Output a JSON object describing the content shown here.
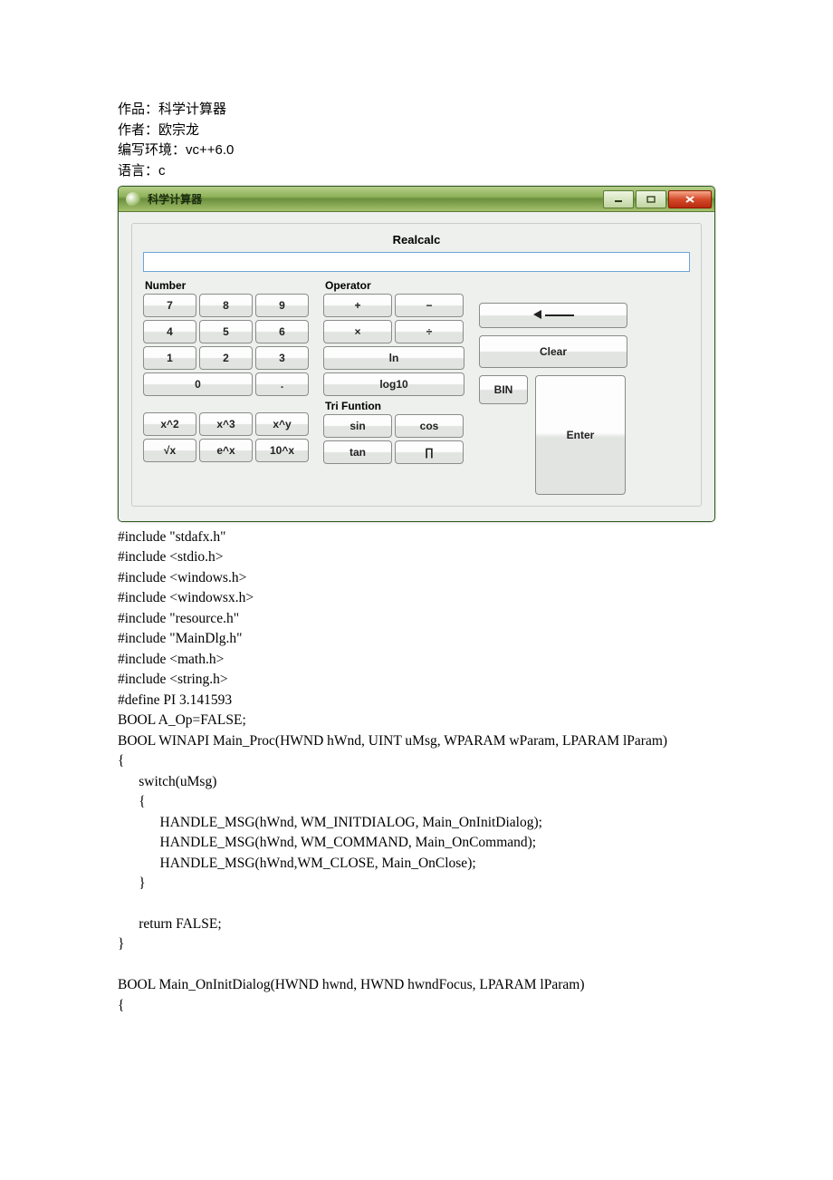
{
  "meta": {
    "work_label": "作品：",
    "work_value": "科学计算器",
    "author_label": "作者：",
    "author_value": "欧宗龙",
    "env_label": "编写环境：",
    "env_value": "vc++6.0",
    "lang_label": "语言：",
    "lang_value": "c"
  },
  "window": {
    "title": "科学计算器"
  },
  "calc": {
    "realcalc": "Realcalc",
    "display_value": "",
    "number_label": "Number",
    "operator_label": "Operator",
    "tri_label": "Tri Funtion",
    "numbers": {
      "n7": "7",
      "n8": "8",
      "n9": "9",
      "n4": "4",
      "n5": "5",
      "n6": "6",
      "n1": "1",
      "n2": "2",
      "n3": "3",
      "n0": "0",
      "dot": "."
    },
    "ops": {
      "add": "+",
      "sub": "−",
      "mul": "×",
      "div": "÷",
      "ln": "ln",
      "log10": "log10",
      "sin": "sin",
      "cos": "cos",
      "tan": "tan",
      "pi": "∏"
    },
    "powers": {
      "x2": "x^2",
      "x3": "x^3",
      "xy": "x^y",
      "sqrt": "√x",
      "ex": "e^x",
      "tenx": "10^x"
    },
    "right": {
      "clear": "Clear",
      "bin": "BIN",
      "enter": "Enter"
    }
  },
  "code": {
    "body": "#include \"stdafx.h\"\n#include <stdio.h>\n#include <windows.h>\n#include <windowsx.h>\n#include \"resource.h\"\n#include \"MainDlg.h\"\n#include <math.h>\n#include <string.h>\n#define PI 3.141593\nBOOL A_Op=FALSE;\nBOOL WINAPI Main_Proc(HWND hWnd, UINT uMsg, WPARAM wParam, LPARAM lParam)\n{\n      switch(uMsg)\n      {\n            HANDLE_MSG(hWnd, WM_INITDIALOG, Main_OnInitDialog);\n            HANDLE_MSG(hWnd, WM_COMMAND, Main_OnCommand);\n            HANDLE_MSG(hWnd,WM_CLOSE, Main_OnClose);\n      }\n\n      return FALSE;\n}\n\nBOOL Main_OnInitDialog(HWND hwnd, HWND hwndFocus, LPARAM lParam)\n{"
  }
}
